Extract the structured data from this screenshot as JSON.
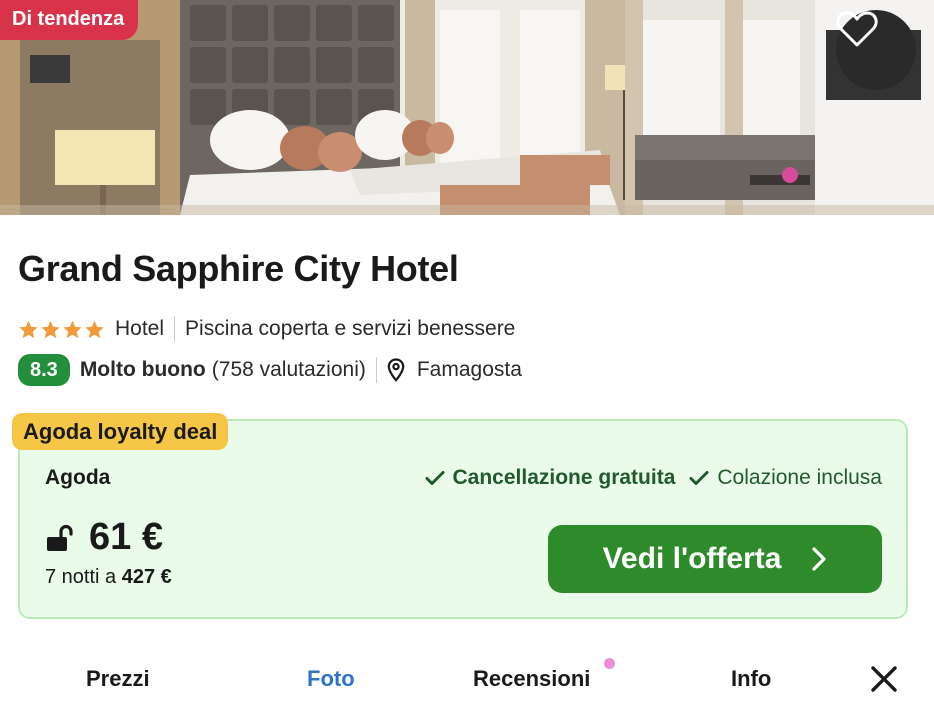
{
  "hero": {
    "badge": "Di tendenza",
    "favorite_icon": "heart-outline-icon"
  },
  "hotel": {
    "name": "Grand Sapphire City Hotel",
    "stars": 4,
    "type": "Hotel",
    "feature": "Piscina coperta e servizi benessere",
    "score": "8.3",
    "rating_word": "Molto buono",
    "reviews": "(758 valutazioni)",
    "location": "Famagosta"
  },
  "deal": {
    "badge": "Agoda loyalty deal",
    "provider": "Agoda",
    "perk1": "Cancellazione gratuita",
    "perk2": "Colazione inclusa",
    "price": "61 €",
    "total_prefix": "7 notti a ",
    "total_value": "427 €",
    "cta": "Vedi l'offerta"
  },
  "tabs": {
    "prezzi": "Prezzi",
    "foto": "Foto",
    "recensioni": "Recensioni",
    "info": "Info"
  },
  "colors": {
    "badge": "#d8334a",
    "score": "#248f3b",
    "cta": "#2e8b2c",
    "active_tab": "#2e73c9",
    "loyalty": "#f6c646"
  }
}
